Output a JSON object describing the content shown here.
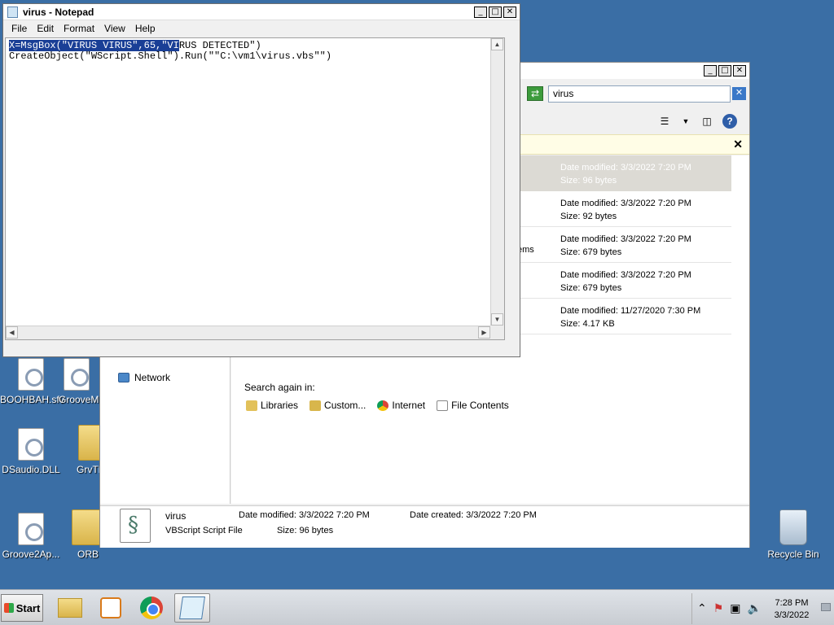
{
  "desktop": {
    "icons": [
      {
        "label": "BOOHBAH.sfv"
      },
      {
        "label": "GrooveM"
      },
      {
        "label": "DSaudio.DLL"
      },
      {
        "label": "GrvTE"
      },
      {
        "label": "Groove2Ap..."
      },
      {
        "label": "ORB"
      },
      {
        "label": "Recycle Bin"
      }
    ]
  },
  "notepad": {
    "title": "virus - Notepad",
    "menu": [
      "File",
      "Edit",
      "Format",
      "View",
      "Help"
    ],
    "line1_selected": "X=MsgBox(\"VIRUS VIRUS\",65,\"VI",
    "line1_rest": "RUS DETECTED\")",
    "line2": "CreateObject(\"WScript.Shell\").Run(\"\"C:\\vm1\\virus.vbs\"\")"
  },
  "explorer": {
    "search_value": "virus",
    "results": [
      {
        "date": "Date modified: 3/3/2022 7:20 PM",
        "size": "Size: 96 bytes",
        "left_text": ""
      },
      {
        "date": "Date modified: 3/3/2022 7:20 PM",
        "size": "Size: 92 bytes",
        "left_text": ""
      },
      {
        "date": "Date modified: 3/3/2022 7:20 PM",
        "size": "Size: 679 bytes",
        "left_text": "ems"
      },
      {
        "date": "Date modified: 3/3/2022 7:20 PM",
        "size": "Size: 679 bytes",
        "left_text": ""
      },
      {
        "date": "Date modified: 11/27/2020 7:30 PM",
        "size": "Size: 4.17 KB",
        "left_text": ""
      }
    ],
    "nav_network": "Network",
    "search_again_label": "Search again in:",
    "search_again_items": [
      "Libraries",
      "Custom...",
      "Internet",
      "File Contents"
    ],
    "details": {
      "name": "virus",
      "type": "VBScript Script File",
      "modified": "Date modified:  3/3/2022 7:20 PM",
      "size": "Size:  96 bytes",
      "created": "Date created:  3/3/2022 7:20 PM"
    }
  },
  "taskbar": {
    "start_label": "Start",
    "clock_time": "7:28 PM",
    "clock_date": "3/3/2022"
  },
  "colors": {
    "desktop": "#3a6ea5",
    "selection": "#1a3f96"
  }
}
